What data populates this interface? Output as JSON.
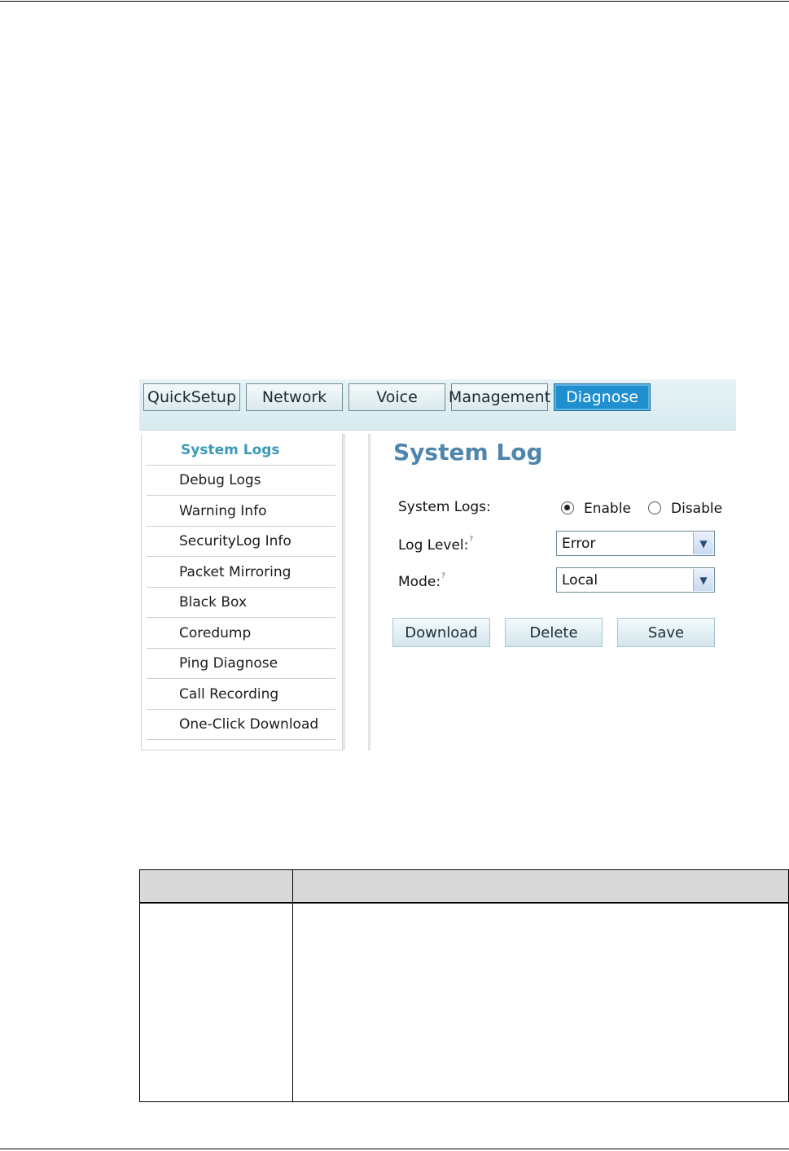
{
  "nav": {
    "tabs": [
      {
        "label": "QuickSetup"
      },
      {
        "label": "Network"
      },
      {
        "label": "Voice"
      },
      {
        "label": "Management"
      },
      {
        "label": "Diagnose",
        "active": true
      }
    ]
  },
  "sidebar": {
    "items": [
      {
        "label": "System Logs",
        "active": true
      },
      {
        "label": "Debug Logs"
      },
      {
        "label": "Warning Info"
      },
      {
        "label": "SecurityLog Info"
      },
      {
        "label": "Packet Mirroring"
      },
      {
        "label": "Black Box"
      },
      {
        "label": "Coredump"
      },
      {
        "label": "Ping Diagnose"
      },
      {
        "label": "Call Recording"
      },
      {
        "label": "One-Click Download"
      }
    ]
  },
  "main": {
    "title": "System Log",
    "system_logs_label": "System Logs:",
    "enable_label": "Enable",
    "disable_label": "Disable",
    "selected_state": "Enable",
    "log_level_label": "Log Level:",
    "log_level_value": "Error",
    "mode_label": "Mode:",
    "mode_value": "Local",
    "help_glyph": "?",
    "buttons": {
      "download": "Download",
      "delete": "Delete",
      "save": "Save"
    }
  },
  "colors": {
    "accent_title": "#4f86ad",
    "active_tab": "#1f8fcf",
    "active_side": "#3a9ab8"
  }
}
